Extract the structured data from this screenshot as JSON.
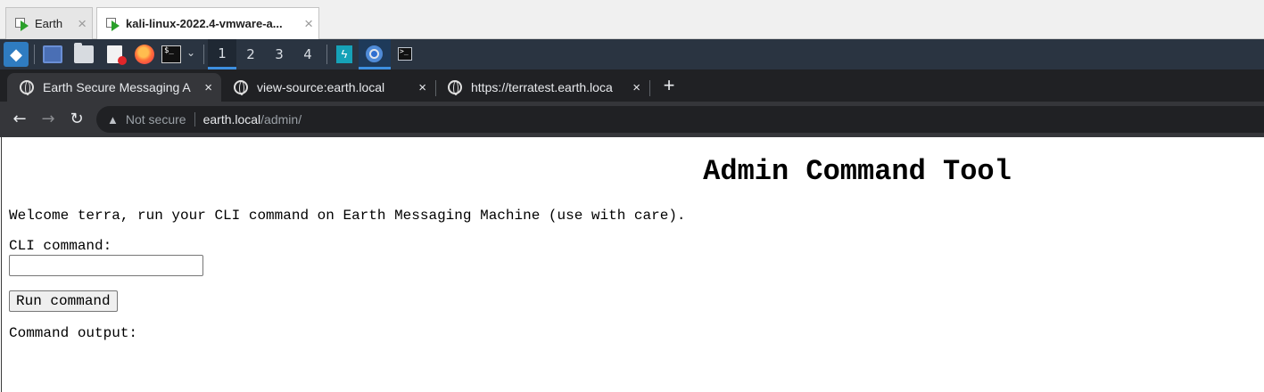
{
  "vm_tabs": [
    {
      "label": "Earth",
      "active": false
    },
    {
      "label": "kali-linux-2022.4-vmware-a...",
      "active": true
    }
  ],
  "panel": {
    "workspaces": [
      "1",
      "2",
      "3",
      "4"
    ],
    "active_workspace": "1"
  },
  "browser": {
    "tabs": [
      {
        "title": "Earth Secure Messaging A",
        "active": true
      },
      {
        "title": "view-source:earth.local",
        "active": false
      },
      {
        "title": "https://terratest.earth.loca",
        "active": false
      }
    ],
    "new_tab": "+",
    "close_glyph": "×",
    "security_label": "Not secure",
    "url_host": "earth.local",
    "url_path": "/admin/"
  },
  "page": {
    "heading": "Admin Command Tool",
    "welcome": "Welcome terra, run your CLI command on Earth Messaging Machine (use with care).",
    "cli_label": "CLI command:",
    "cli_value": "",
    "run_button": "Run command",
    "output_label": "Command output:"
  }
}
